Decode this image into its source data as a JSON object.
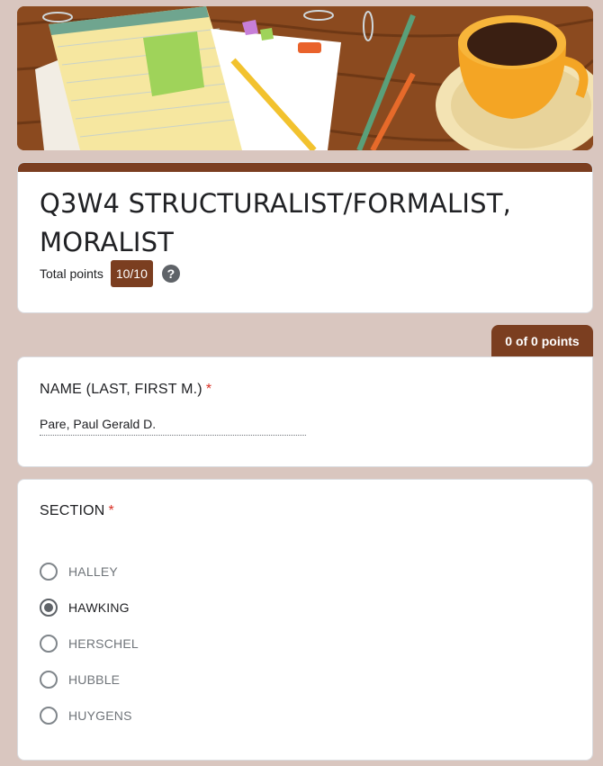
{
  "form": {
    "title": "Q3W4 STRUCTURALIST/FORMALIST, MORALIST",
    "total_points_label": "Total points",
    "total_points_value": "10/10",
    "help_icon": "?",
    "section_points": "0 of 0 points",
    "accent_color": "#7b3e20"
  },
  "questions": {
    "name": {
      "title": "NAME (LAST, FIRST M.)",
      "required_mark": "*",
      "answer": "Pare, Paul Gerald D."
    },
    "section": {
      "title": "SECTION",
      "required_mark": "*",
      "options": [
        {
          "label": "HALLEY",
          "selected": false
        },
        {
          "label": "HAWKING",
          "selected": true
        },
        {
          "label": "HERSCHEL",
          "selected": false
        },
        {
          "label": "HUBBLE",
          "selected": false
        },
        {
          "label": "HUYGENS",
          "selected": false
        }
      ]
    }
  }
}
